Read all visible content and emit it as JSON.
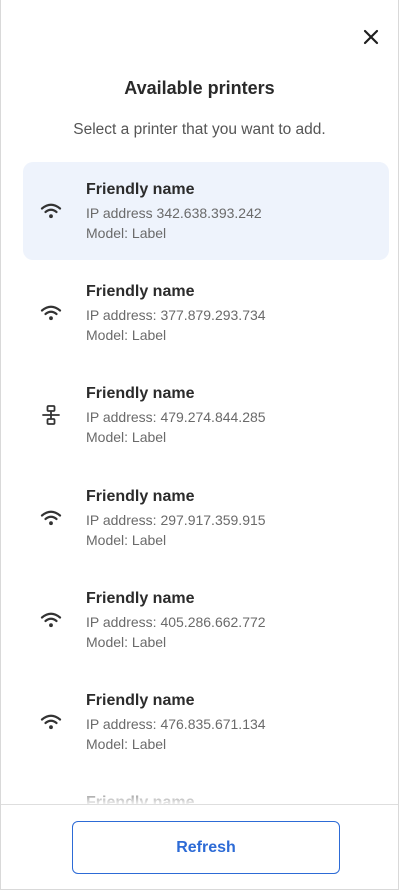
{
  "dialog": {
    "title": "Available printers",
    "subtitle": "Select a printer that you want to add.",
    "close_icon": "close-icon",
    "refresh_label": "Refresh"
  },
  "printers": [
    {
      "name": "Friendly name",
      "ip": "IP address 342.638.393.242",
      "model": "Model: Label",
      "connection": "wifi-icon",
      "selected": true
    },
    {
      "name": "Friendly name",
      "ip": "IP address: 377.879.293.734",
      "model": "Model: Label",
      "connection": "wifi-icon",
      "selected": false
    },
    {
      "name": "Friendly name",
      "ip": "IP address: 479.274.844.285",
      "model": "Model: Label",
      "connection": "network-icon",
      "selected": false
    },
    {
      "name": "Friendly name",
      "ip": "IP address: 297.917.359.915",
      "model": "Model: Label",
      "connection": "wifi-icon",
      "selected": false
    },
    {
      "name": "Friendly name",
      "ip": "IP address: 405.286.662.772",
      "model": "Model: Label",
      "connection": "wifi-icon",
      "selected": false
    },
    {
      "name": "Friendly name",
      "ip": "IP address: 476.835.671.134",
      "model": "Model: Label",
      "connection": "wifi-icon",
      "selected": false
    },
    {
      "name": "Friendly name",
      "ip": "",
      "model": "",
      "connection": "wifi-icon",
      "selected": false
    }
  ],
  "colors": {
    "accent": "#2d6bd6",
    "selected_bg": "#eef3fc",
    "icon": "#333333"
  }
}
